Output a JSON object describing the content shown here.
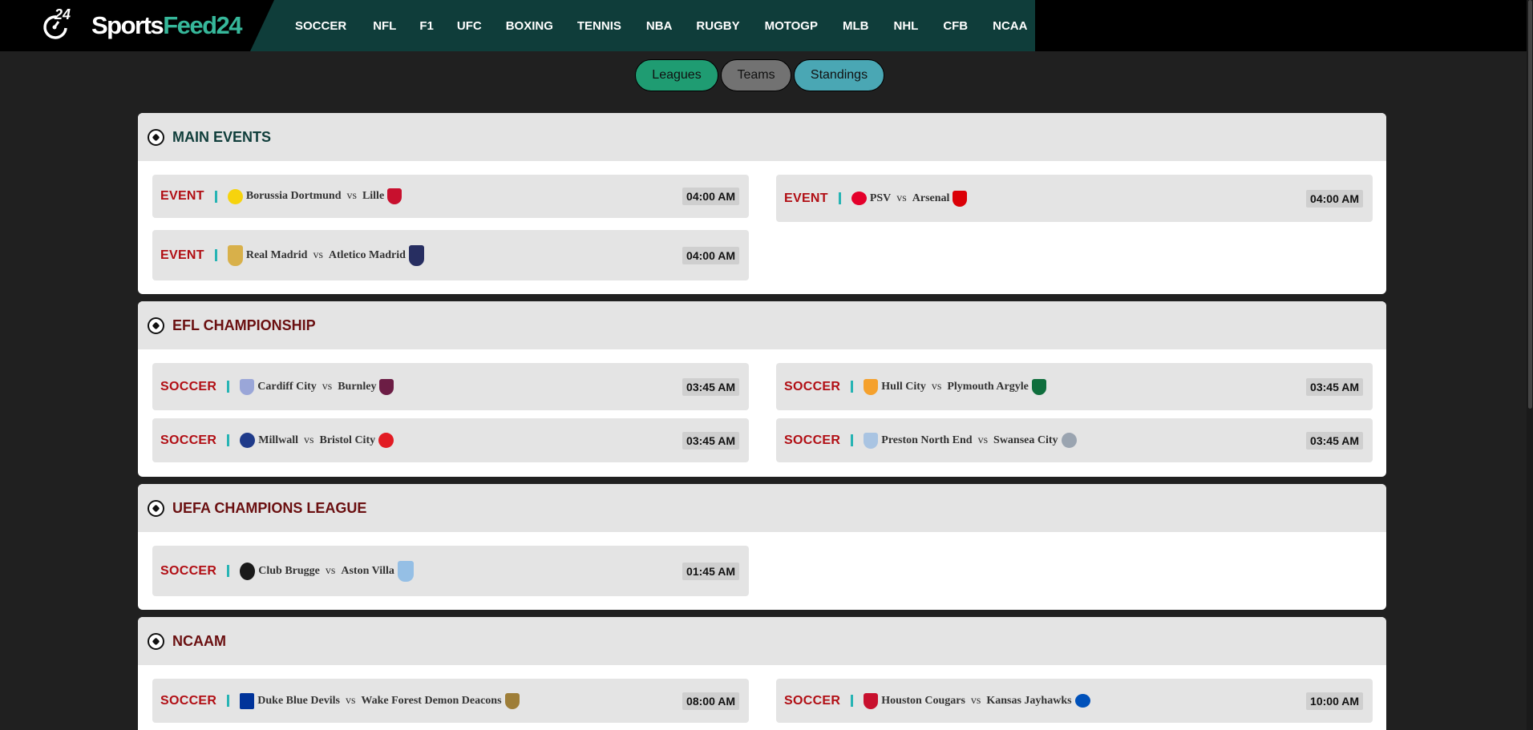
{
  "brand": {
    "badge": "24",
    "name_part1": "Sports",
    "name_part2": "Feed24"
  },
  "nav": [
    "SOCCER",
    "NFL",
    "F1",
    "UFC",
    "BOXING",
    "TENNIS",
    "NBA",
    "RUGBY",
    "MOTOGP",
    "MLB",
    "NHL",
    "CFB",
    "NCAA"
  ],
  "filters": {
    "leagues": "Leagues",
    "teams": "Teams",
    "standings": "Standings"
  },
  "sections": [
    {
      "title": "MAIN EVENTS",
      "events": [
        {
          "label": "EVENT",
          "home": "Borussia Dortmund",
          "vs": "vs",
          "away": "Lille",
          "time": "04:00 AM",
          "home_color": "#f6d30d",
          "away_color": "#c8102e"
        },
        {
          "label": "EVENT",
          "home": "PSV",
          "vs": "vs",
          "away": "Arsenal",
          "time": "04:00 AM",
          "home_color": "#e4002b",
          "away_color": "#db0007"
        },
        {
          "label": "EVENT",
          "home": "Real Madrid",
          "vs": "vs",
          "away": "Atletico Madrid",
          "time": "04:00 AM",
          "home_color": "#d8b04a",
          "away_color": "#272e61"
        }
      ]
    },
    {
      "title": "EFL CHAMPIONSHIP",
      "events": [
        {
          "label": "SOCCER",
          "home": "Cardiff City",
          "vs": "vs",
          "away": "Burnley",
          "time": "03:45 AM",
          "home_color": "#9aa6d8",
          "away_color": "#6c1d45"
        },
        {
          "label": "SOCCER",
          "home": "Hull City",
          "vs": "vs",
          "away": "Plymouth Argyle",
          "time": "03:45 AM",
          "home_color": "#f5a12d",
          "away_color": "#0f6e3d"
        },
        {
          "label": "SOCCER",
          "home": "Millwall",
          "vs": "vs",
          "away": "Bristol City",
          "time": "03:45 AM",
          "home_color": "#1f3b8a",
          "away_color": "#e21b23"
        },
        {
          "label": "SOCCER",
          "home": "Preston North End",
          "vs": "vs",
          "away": "Swansea City",
          "time": "03:45 AM",
          "home_color": "#a9c4e2",
          "away_color": "#9aa4b0"
        }
      ]
    },
    {
      "title": "UEFA CHAMPIONS LEAGUE",
      "events": [
        {
          "label": "SOCCER",
          "home": "Club Brugge",
          "vs": "vs",
          "away": "Aston Villa",
          "time": "01:45 AM",
          "home_color": "#1a1a1a",
          "away_color": "#95bfe5"
        }
      ]
    },
    {
      "title": "NCAAM",
      "events": [
        {
          "label": "SOCCER",
          "home": "Duke Blue Devils",
          "vs": "vs",
          "away": "Wake Forest Demon Deacons",
          "time": "08:00 AM",
          "home_color": "#00339a",
          "away_color": "#9e7e38"
        },
        {
          "label": "SOCCER",
          "home": "Houston Cougars",
          "vs": "vs",
          "away": "Kansas Jayhawks",
          "time": "10:00 AM",
          "home_color": "#c8102e",
          "away_color": "#0051ba"
        }
      ]
    }
  ]
}
